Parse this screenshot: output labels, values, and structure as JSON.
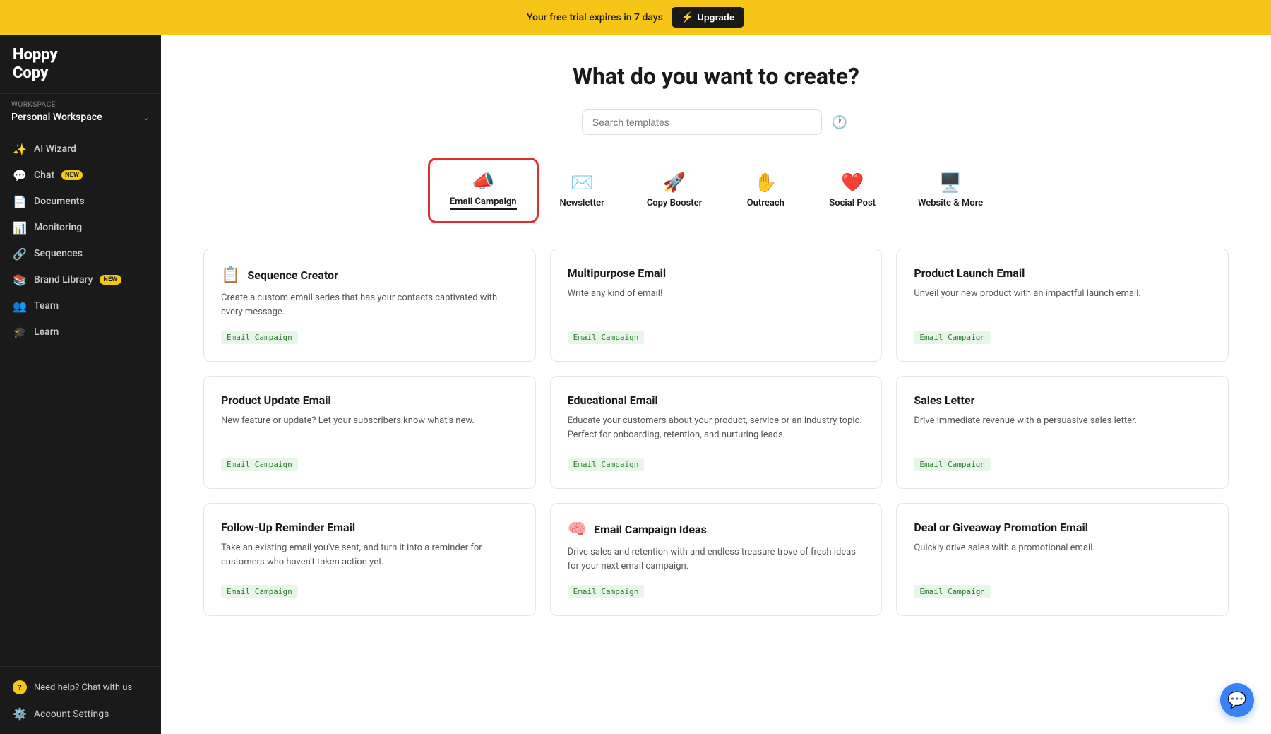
{
  "banner": {
    "text": "Your free trial expires in 7 days",
    "upgrade_label": "Upgrade",
    "bolt_icon": "⚡"
  },
  "logo": {
    "line1": "Hoppy",
    "line2": "Copy"
  },
  "workspace": {
    "label": "Workspace",
    "name": "Personal Workspace"
  },
  "nav": {
    "items": [
      {
        "id": "ai-wizard",
        "label": "AI Wizard",
        "icon": "✨",
        "badge": null
      },
      {
        "id": "chat",
        "label": "Chat",
        "icon": "💬",
        "badge": "new"
      },
      {
        "id": "documents",
        "label": "Documents",
        "icon": "📄",
        "badge": null
      },
      {
        "id": "monitoring",
        "label": "Monitoring",
        "icon": "📊",
        "badge": null
      },
      {
        "id": "sequences",
        "label": "Sequences",
        "icon": "🔗",
        "badge": null
      },
      {
        "id": "brand-library",
        "label": "Brand Library",
        "icon": "📚",
        "badge": "new"
      },
      {
        "id": "team",
        "label": "Team",
        "icon": "👥",
        "badge": null
      },
      {
        "id": "learn",
        "label": "Learn",
        "icon": "🎓",
        "badge": null
      }
    ],
    "help": "Need help? Chat with us",
    "account_settings": "Account Settings"
  },
  "main": {
    "title": "What do you want to create?",
    "search_placeholder": "Search templates",
    "categories": [
      {
        "id": "email-campaign",
        "label": "Email Campaign",
        "icon": "📣",
        "active": true
      },
      {
        "id": "newsletter",
        "label": "Newsletter",
        "icon": "✉️",
        "active": false
      },
      {
        "id": "copy-booster",
        "label": "Copy Booster",
        "icon": "🚀",
        "active": false
      },
      {
        "id": "outreach",
        "label": "Outreach",
        "icon": "✋",
        "active": false
      },
      {
        "id": "social-post",
        "label": "Social Post",
        "icon": "❤️",
        "active": false
      },
      {
        "id": "website-more",
        "label": "Website & More",
        "icon": "🖥️",
        "active": false
      }
    ],
    "templates": [
      {
        "id": "sequence-creator",
        "icon": "📋",
        "title": "Sequence Creator",
        "description": "Create a custom email series that has your contacts captivated with every message.",
        "tag": "Email Campaign"
      },
      {
        "id": "multipurpose-email",
        "icon": null,
        "title": "Multipurpose Email",
        "description": "Write any kind of email!",
        "tag": "Email Campaign"
      },
      {
        "id": "product-launch-email",
        "icon": null,
        "title": "Product Launch Email",
        "description": "Unveil your new product with an impactful launch email.",
        "tag": "Email Campaign"
      },
      {
        "id": "product-update-email",
        "icon": null,
        "title": "Product Update Email",
        "description": "New feature or update? Let your subscribers know what's new.",
        "tag": "Email Campaign"
      },
      {
        "id": "educational-email",
        "icon": null,
        "title": "Educational Email",
        "description": "Educate your customers about your product, service or an industry topic. Perfect for onboarding, retention, and nurturing leads.",
        "tag": "Email Campaign"
      },
      {
        "id": "sales-letter",
        "icon": null,
        "title": "Sales Letter",
        "description": "Drive immediate revenue with a persuasive sales letter.",
        "tag": "Email Campaign"
      },
      {
        "id": "followup-reminder",
        "icon": null,
        "title": "Follow-Up Reminder Email",
        "description": "Take an existing email you've sent, and turn it into a reminder for customers who haven't taken action yet.",
        "tag": "Email Campaign"
      },
      {
        "id": "campaign-ideas",
        "icon": "🧠",
        "title": "Email Campaign Ideas",
        "description": "Drive sales and retention with and endless treasure trove of fresh ideas for your next email campaign.",
        "tag": "Email Campaign"
      },
      {
        "id": "deal-giveaway",
        "icon": null,
        "title": "Deal or Giveaway Promotion Email",
        "description": "Quickly drive sales with a promotional email.",
        "tag": "Email Campaign"
      }
    ]
  }
}
